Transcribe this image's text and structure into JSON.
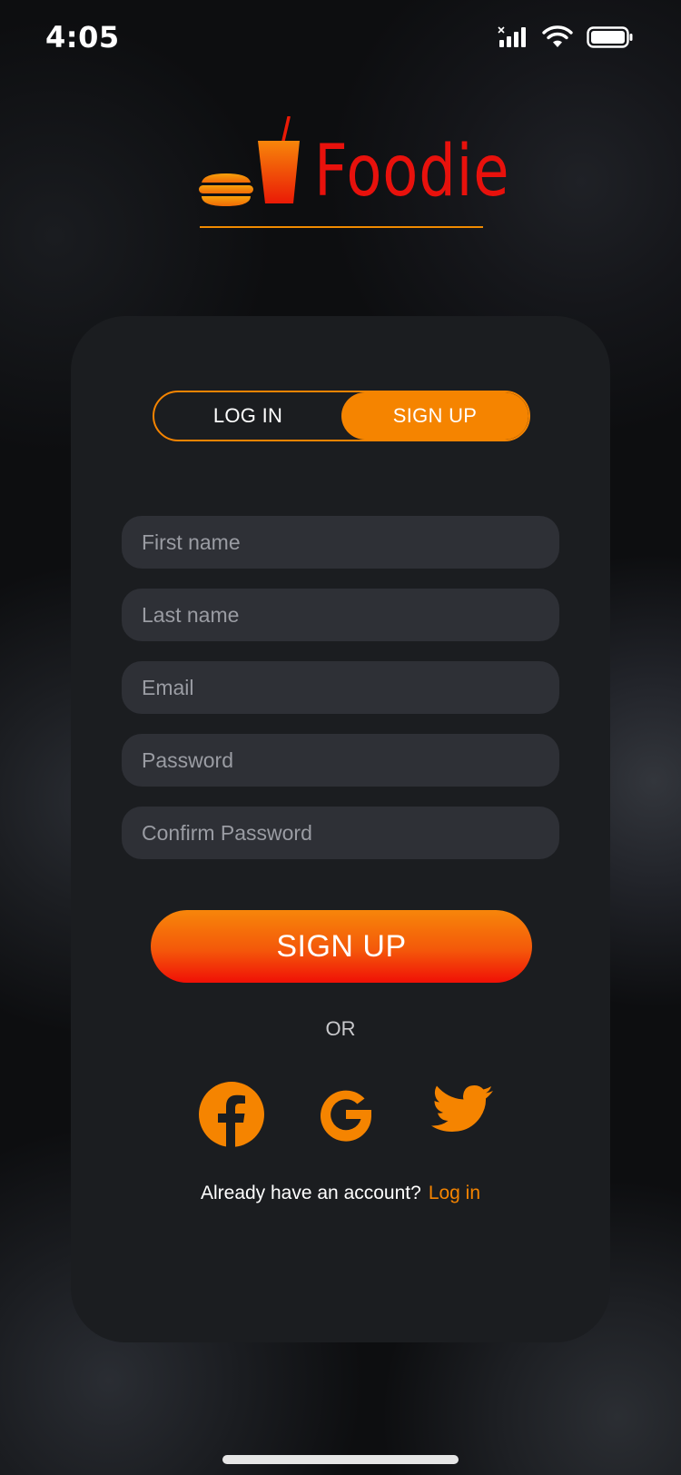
{
  "status_bar": {
    "time": "4:05",
    "icons": [
      "cellular-signal-icon",
      "wifi-icon",
      "battery-icon"
    ]
  },
  "logo": {
    "text": "Foodie",
    "icons": [
      "burger-icon",
      "drink-cup-icon"
    ]
  },
  "auth_toggle": {
    "login_label": "LOG IN",
    "signup_label": "SIGN UP",
    "active": "signup"
  },
  "form": {
    "first_name_placeholder": "First name",
    "last_name_placeholder": "Last name",
    "email_placeholder": "Email",
    "password_placeholder": "Password",
    "confirm_password_placeholder": "Confirm Password",
    "submit_label": "SIGN UP",
    "or_label": "OR"
  },
  "social": {
    "icons": [
      "facebook-icon",
      "google-icon",
      "twitter-icon"
    ]
  },
  "footer": {
    "prompt": "Already have an account?",
    "link": "Log in"
  },
  "colors": {
    "accent": "#f58400",
    "brand_red": "#e8110c",
    "card": "#1b1d20",
    "field": "#2e3036"
  }
}
